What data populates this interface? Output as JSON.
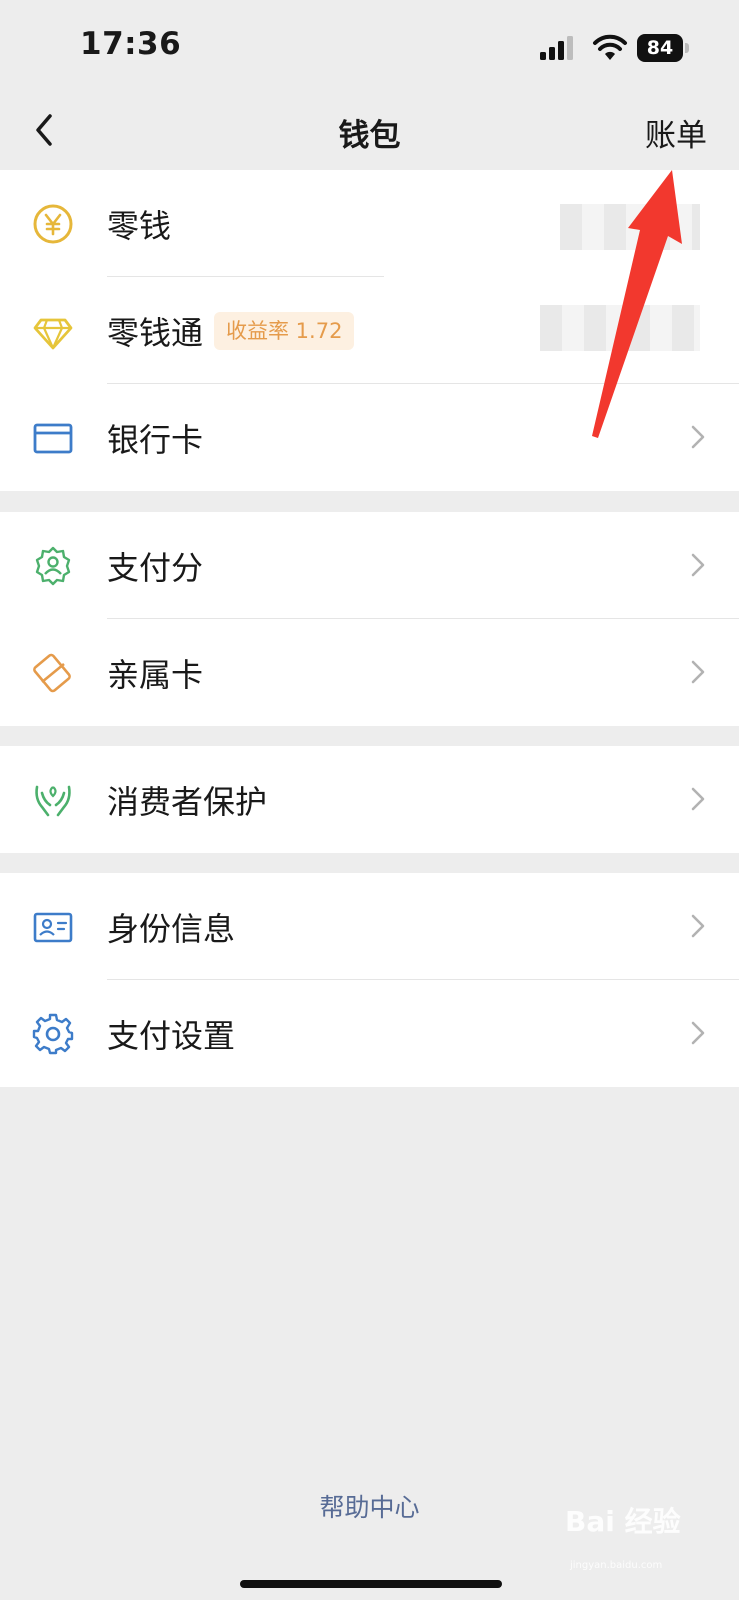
{
  "status": {
    "time": "17:36",
    "battery": "84"
  },
  "nav": {
    "title": "钱包",
    "right_label": "账单"
  },
  "group1": [
    {
      "label": "零钱",
      "icon": "yen-coin-icon"
    },
    {
      "label": "零钱通",
      "icon": "diamond-icon",
      "badge": "收益率 1.72"
    },
    {
      "label": "银行卡",
      "icon": "bank-card-icon"
    }
  ],
  "group2": [
    {
      "label": "支付分",
      "icon": "badge-person-icon"
    },
    {
      "label": "亲属卡",
      "icon": "family-card-icon"
    }
  ],
  "group3": [
    {
      "label": "消费者保护",
      "icon": "hands-protect-icon"
    }
  ],
  "group4": [
    {
      "label": "身份信息",
      "icon": "id-card-icon"
    },
    {
      "label": "支付设置",
      "icon": "gear-icon"
    }
  ],
  "footer": {
    "help": "帮助中心"
  },
  "watermark": {
    "brand": "Bai 经验",
    "url": "jingyan.baidu.com"
  },
  "colors": {
    "yellow": "#e6b73a",
    "blue": "#3d7cc9",
    "green": "#4cb06c",
    "orange": "#e59b4b",
    "link": "#576b95",
    "annotation": "#f2382e"
  }
}
